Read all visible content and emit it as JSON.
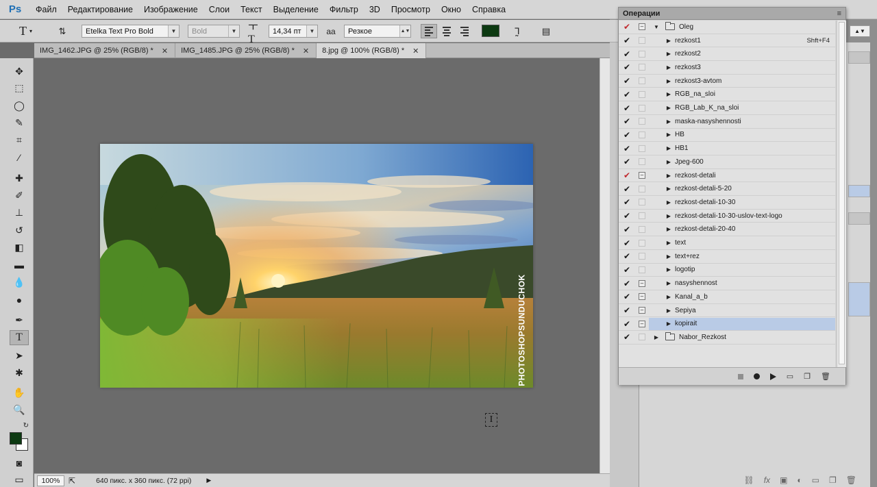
{
  "app": {
    "logo": "Ps"
  },
  "menu": [
    "Файл",
    "Редактирование",
    "Изображение",
    "Слои",
    "Текст",
    "Выделение",
    "Фильтр",
    "3D",
    "Просмотр",
    "Окно",
    "Справка"
  ],
  "options_bar": {
    "font_family": "Etelka Text Pro Bold",
    "font_style": "Bold",
    "font_size": "14,34 пт",
    "antialias_icon": "aa",
    "antialias": "Резкое",
    "text_color": "#0d3a12"
  },
  "tabs": [
    {
      "label": "IMG_1462.JPG @ 25% (RGB/8) *"
    },
    {
      "label": "IMG_1485.JPG @ 25% (RGB/8) *"
    },
    {
      "label": "8.jpg @ 100% (RGB/8) *"
    }
  ],
  "photo": {
    "watermark": "PHOTOSHOPSUNDUCHOK"
  },
  "status": {
    "zoom": "100%",
    "info": "640 пикс. x 360 пикс. (72 ppi)"
  },
  "actions_panel": {
    "title": "Операции",
    "rows": [
      {
        "type": "set",
        "check": "red",
        "dialog": "on",
        "expanded": true,
        "label": "Oleg",
        "shortcut": ""
      },
      {
        "type": "action",
        "check": "black",
        "dialog": "none",
        "label": "rezkost1",
        "shortcut": "Shft+F4"
      },
      {
        "type": "action",
        "check": "black",
        "dialog": "none",
        "label": "rezkost2",
        "shortcut": ""
      },
      {
        "type": "action",
        "check": "black",
        "dialog": "none",
        "label": "rezkost3",
        "shortcut": ""
      },
      {
        "type": "action",
        "check": "black",
        "dialog": "none",
        "label": "rezkost3-avtom",
        "shortcut": ""
      },
      {
        "type": "action",
        "check": "black",
        "dialog": "none",
        "label": "RGB_na_sloi",
        "shortcut": ""
      },
      {
        "type": "action",
        "check": "black",
        "dialog": "none",
        "label": "RGB_Lab_K_na_sloi",
        "shortcut": ""
      },
      {
        "type": "action",
        "check": "black",
        "dialog": "none",
        "label": "maska-nasyshennosti",
        "shortcut": ""
      },
      {
        "type": "action",
        "check": "black",
        "dialog": "none",
        "label": "HB",
        "shortcut": ""
      },
      {
        "type": "action",
        "check": "black",
        "dialog": "none",
        "label": "HB1",
        "shortcut": ""
      },
      {
        "type": "action",
        "check": "black",
        "dialog": "none",
        "label": "Jpeg-600",
        "shortcut": ""
      },
      {
        "type": "action",
        "check": "red",
        "dialog": "on",
        "label": "rezkost-detali",
        "shortcut": ""
      },
      {
        "type": "action",
        "check": "black",
        "dialog": "none",
        "label": "rezkost-detali-5-20",
        "shortcut": ""
      },
      {
        "type": "action",
        "check": "black",
        "dialog": "none",
        "label": "rezkost-detali-10-30",
        "shortcut": ""
      },
      {
        "type": "action",
        "check": "black",
        "dialog": "none",
        "label": "rezkost-detali-10-30-uslov-text-logo",
        "shortcut": ""
      },
      {
        "type": "action",
        "check": "black",
        "dialog": "none",
        "label": "rezkost-detali-20-40",
        "shortcut": ""
      },
      {
        "type": "action",
        "check": "black",
        "dialog": "none",
        "label": "text",
        "shortcut": ""
      },
      {
        "type": "action",
        "check": "black",
        "dialog": "none",
        "label": "text+rez",
        "shortcut": ""
      },
      {
        "type": "action",
        "check": "black",
        "dialog": "none",
        "label": "logotip",
        "shortcut": ""
      },
      {
        "type": "action",
        "check": "black",
        "dialog": "on",
        "label": "nasyshennost",
        "shortcut": ""
      },
      {
        "type": "action",
        "check": "black",
        "dialog": "on",
        "label": "Kanal_a_b",
        "shortcut": ""
      },
      {
        "type": "action",
        "check": "black",
        "dialog": "on",
        "label": "Sepiya",
        "shortcut": ""
      },
      {
        "type": "action",
        "check": "black",
        "dialog": "on",
        "label": "kopirait",
        "shortcut": "",
        "selected": true
      },
      {
        "type": "set",
        "check": "black",
        "dialog": "none",
        "expanded": false,
        "label": "Nabor_Rezkost",
        "shortcut": ""
      }
    ]
  }
}
